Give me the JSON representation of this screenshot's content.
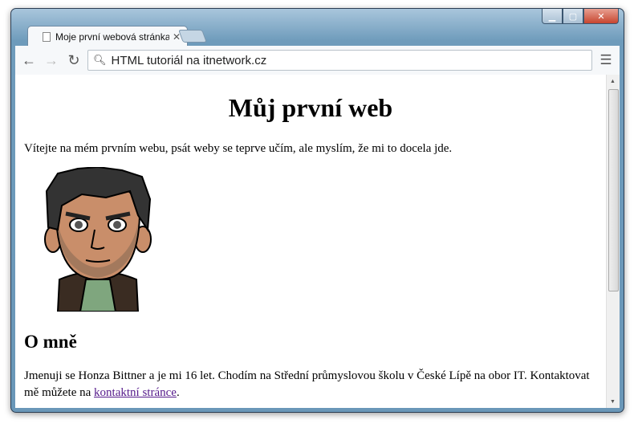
{
  "browser": {
    "tab_title": "Moje první webová stránka",
    "address": "HTML tutoriál na itnetwork.cz"
  },
  "page": {
    "heading": "Můj první web",
    "intro": "Vítejte na mém prvním webu, psát weby se teprve učím, ale myslím, že mi to docela jde.",
    "about_heading": "O mně",
    "about_text": "Jmenuji se Honza Bittner a je mi 16 let. Chodím na Střední průmyslovou školu v České Lípě na obor IT. Kontaktovat mě můžete na ",
    "contact_link": "kontaktní stránce",
    "about_end": "."
  }
}
